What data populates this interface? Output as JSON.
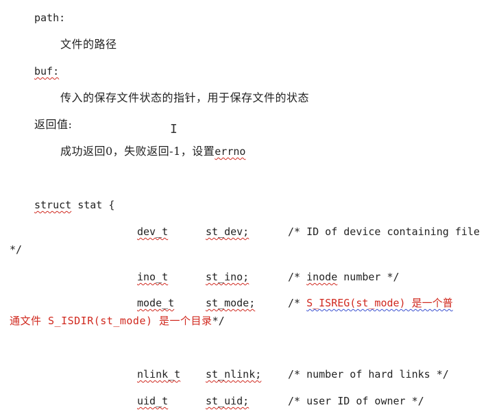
{
  "params": {
    "path_label": "path:",
    "path_desc": "文件的路径",
    "buf_label": "buf:",
    "buf_desc": "传入的保存文件状态的指针，用于保存文件的状态",
    "ret_label": "返回值:",
    "ret_desc_prefix": "成功返回0，失败返回-1，设置",
    "ret_desc_errno": "errno"
  },
  "struct": {
    "keyword": "struct",
    "name_brace": "stat {",
    "fields": [
      {
        "type": "dev_t",
        "name": "st_dev;",
        "comment": "/* ID of device containing file"
      },
      {
        "type": "ino_t",
        "name": "st_ino;",
        "comment_prefix": "/*",
        "comment_word": "inode",
        "comment_rest": "number */"
      },
      {
        "type": "mode_t",
        "name": "st_mode;",
        "comment_prefix": "/*",
        "comment_red": "S_ISREG(st_mode)  是一个普"
      },
      {
        "type": "nlink_t",
        "name": "st_nlink;",
        "comment": "/* number of hard links */"
      },
      {
        "type": "uid_t",
        "name": "st_uid;",
        "comment": "/* user ID of owner */"
      }
    ],
    "wrap_close_1": "*/",
    "wrap_red_2": "通文件  S_ISDIR(st_mode)  是一个目录",
    "wrap_close_2": "*/"
  },
  "cursor_glyph": "I"
}
